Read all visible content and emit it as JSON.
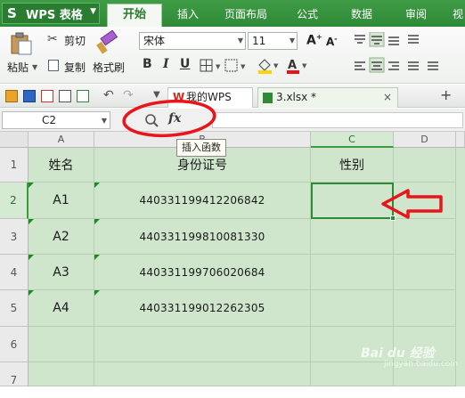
{
  "app": {
    "title": "WPS 表格"
  },
  "menu": {
    "tabs": [
      {
        "label": "开始",
        "active": true
      },
      {
        "label": "插入"
      },
      {
        "label": "页面布局"
      },
      {
        "label": "公式"
      },
      {
        "label": "数据"
      },
      {
        "label": "审阅"
      },
      {
        "label": "视"
      }
    ]
  },
  "ribbon": {
    "paste_label": "粘贴",
    "cut_label": "剪切",
    "copy_label": "复制",
    "format_painter_label": "格式刷",
    "font_name": "宋体",
    "font_size": "11",
    "bold": "B",
    "italic": "I",
    "underline": "U"
  },
  "doc_tabs": [
    {
      "label": "我的WPS"
    },
    {
      "label": "3.xlsx *"
    }
  ],
  "formula_bar": {
    "cell_ref": "C2",
    "fx_label": "fx",
    "tooltip": "插入函数"
  },
  "sheet": {
    "columns": [
      "A",
      "B",
      "C",
      "D"
    ],
    "selected_column": "C",
    "rows": [
      "1",
      "2",
      "3",
      "4",
      "5",
      "6",
      "7"
    ],
    "selected_row": "2",
    "header_row": {
      "a": "姓名",
      "b": "身份证号",
      "c": "性别"
    },
    "data_rows": [
      {
        "a": "A1",
        "b": "440331199412206842",
        "c": ""
      },
      {
        "a": "A2",
        "b": "440331199810081330",
        "c": ""
      },
      {
        "a": "A3",
        "b": "440331199706020684",
        "c": ""
      },
      {
        "a": "A4",
        "b": "440331199012262305",
        "c": ""
      }
    ]
  },
  "annotations": {
    "color": "#e8151b"
  },
  "watermark": {
    "text": "Bai du 经验",
    "sub": "jingyan.baidu.com"
  },
  "colors": {
    "brand_green": "#2f8a37",
    "sheet_fill": "#cfe6cd"
  }
}
